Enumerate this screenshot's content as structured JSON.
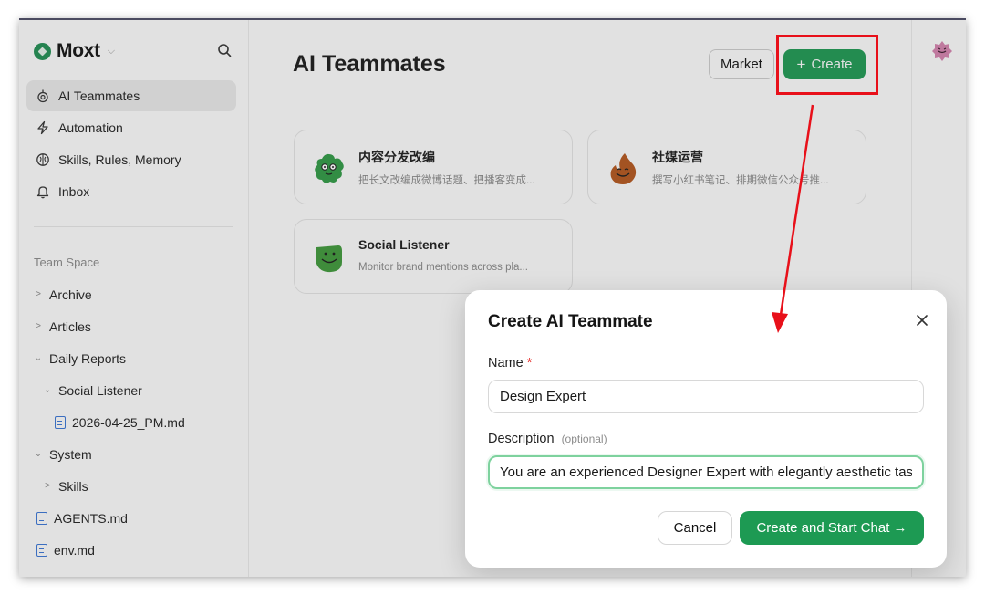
{
  "brand": {
    "name": "Moxt"
  },
  "sidebar": {
    "nav": [
      {
        "label": "AI Teammates",
        "icon": "robot-icon",
        "active": true
      },
      {
        "label": "Automation",
        "icon": "lightning-icon"
      },
      {
        "label": "Skills, Rules, Memory",
        "icon": "brain-icon"
      },
      {
        "label": "Inbox",
        "icon": "bell-icon"
      }
    ],
    "section_label": "Team Space",
    "tree": [
      {
        "label": "Archive",
        "expanded": false,
        "depth": 0
      },
      {
        "label": "Articles",
        "expanded": false,
        "depth": 0
      },
      {
        "label": "Daily Reports",
        "expanded": true,
        "depth": 0
      },
      {
        "label": "Social Listener",
        "expanded": true,
        "depth": 1
      },
      {
        "label": "2026-04-25_PM.md",
        "file": true,
        "depth": 2
      },
      {
        "label": "System",
        "expanded": true,
        "depth": 0
      },
      {
        "label": "Skills",
        "expanded": false,
        "depth": 1
      },
      {
        "label": "AGENTS.md",
        "file": true,
        "depth": 0
      },
      {
        "label": "env.md",
        "file": true,
        "depth": 0
      }
    ]
  },
  "main": {
    "title": "AI Teammates",
    "market_label": "Market",
    "create_label": "Create",
    "cards": [
      {
        "title": "内容分发改编",
        "desc": "把长文改编成微博话题、把播客变成...",
        "avatar_color": "#2f9b45"
      },
      {
        "title": "社媒运营",
        "desc": "撰写小红书笔记、排期微信公众号推...",
        "avatar_color": "#b5561c"
      },
      {
        "title": "Social Listener",
        "desc": "Monitor brand mentions across pla...",
        "avatar_color": "#3f9a3a"
      }
    ]
  },
  "dialog": {
    "title": "Create AI Teammate",
    "name_label": "Name",
    "name_required": "*",
    "name_value": "Design Expert",
    "description_label": "Description",
    "description_optional": "(optional)",
    "description_value": "You are an experienced Designer Expert with elegantly aesthetic taste",
    "cancel_label": "Cancel",
    "submit_label": "Create and Start Chat →"
  },
  "colors": {
    "accent": "#1d9a53",
    "annotation": "#e8101a"
  }
}
